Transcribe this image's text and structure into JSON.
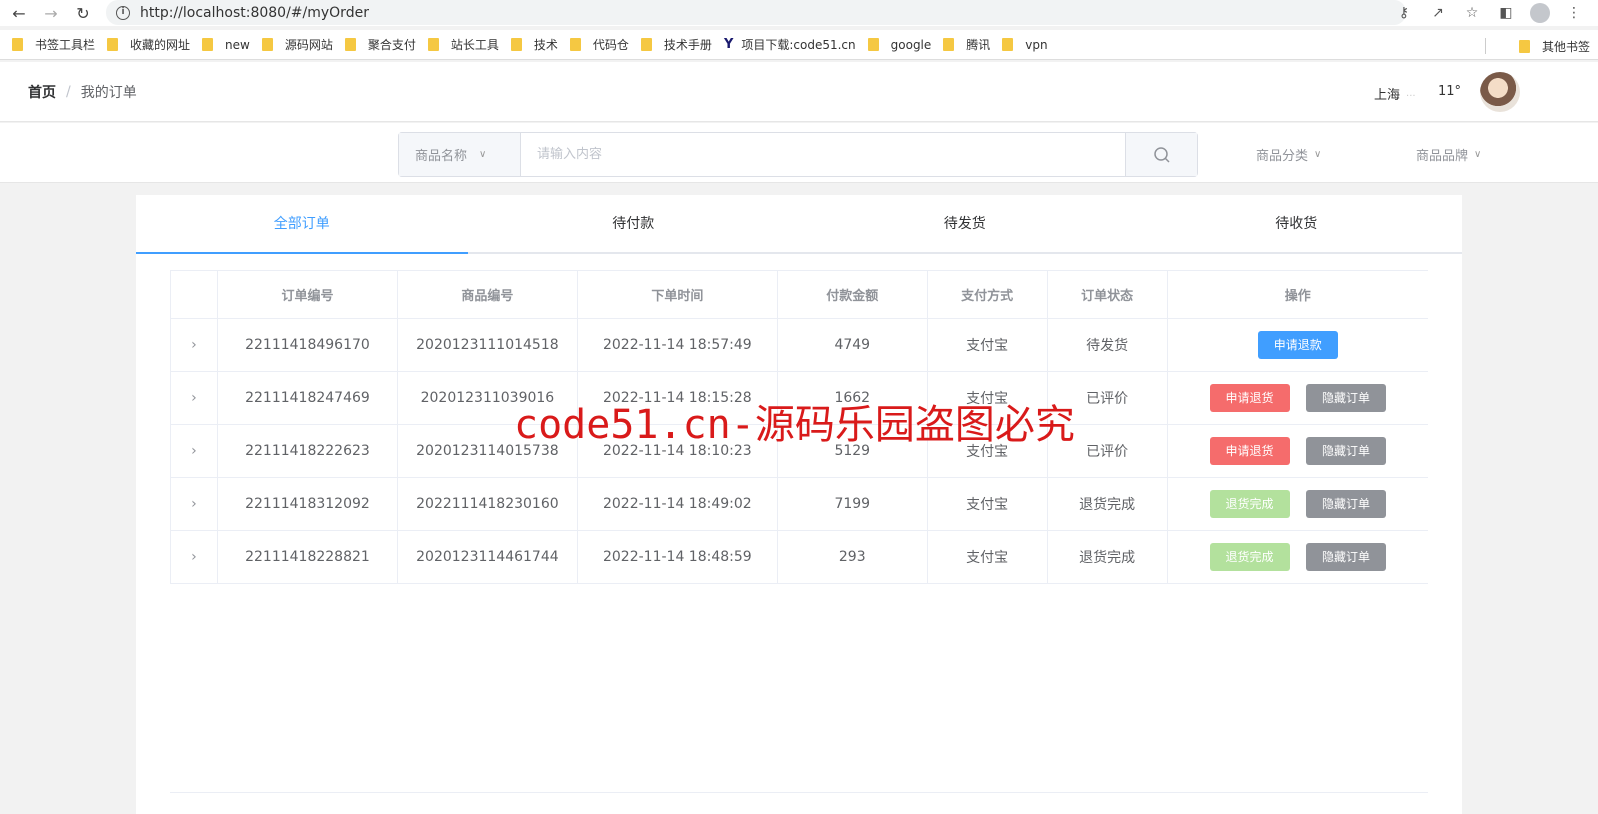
{
  "browser": {
    "url": "http://localhost:8080/#/myOrder",
    "bookmarks": [
      "书签工具栏",
      "收藏的网址",
      "new",
      "源码网站",
      "聚合支付",
      "站长工具",
      "技术",
      "代码仓",
      "技术手册"
    ],
    "bookmark_special": "项目下载:code51.cn",
    "bookmarks_tail": [
      "google",
      "腾讯",
      "vpn"
    ],
    "bookmark_other": "其他书签"
  },
  "header": {
    "breadcrumb_home": "首页",
    "breadcrumb_sep": "/",
    "breadcrumb_current": "我的订单",
    "city": "上海",
    "weather_dots": "...",
    "temperature": "11°"
  },
  "search": {
    "select_label": "商品名称",
    "placeholder": "请输入内容",
    "category_label": "商品分类",
    "brand_label": "商品品牌"
  },
  "tabs": [
    "全部订单",
    "待付款",
    "待发货",
    "待收货"
  ],
  "table": {
    "columns": [
      "订单编号",
      "商品编号",
      "下单时间",
      "付款金额",
      "支付方式",
      "订单状态",
      "操作"
    ],
    "rows": [
      {
        "order_no": "22111418496170",
        "product_no": "2020123111014518",
        "time": "2022-11-14 18:57:49",
        "amount": "4749",
        "pay": "支付宝",
        "status": "待发货",
        "actions": [
          "申请退款"
        ]
      },
      {
        "order_no": "22111418247469",
        "product_no": "202012311039016",
        "time": "2022-11-14 18:15:28",
        "amount": "1662",
        "pay": "支付宝",
        "status": "已评价",
        "actions": [
          "申请退货",
          "隐藏订单"
        ]
      },
      {
        "order_no": "22111418222623",
        "product_no": "2020123114015738",
        "time": "2022-11-14 18:10:23",
        "amount": "5129",
        "pay": "支付宝",
        "status": "已评价",
        "actions": [
          "申请退货",
          "隐藏订单"
        ]
      },
      {
        "order_no": "22111418312092",
        "product_no": "2022111418230160",
        "time": "2022-11-14 18:49:02",
        "amount": "7199",
        "pay": "支付宝",
        "status": "退货完成",
        "actions": [
          "退货完成",
          "隐藏订单"
        ]
      },
      {
        "order_no": "22111418228821",
        "product_no": "2020123114461744",
        "time": "2022-11-14 18:48:59",
        "amount": "293",
        "pay": "支付宝",
        "status": "退货完成",
        "actions": [
          "退货完成",
          "隐藏订单"
        ]
      }
    ]
  },
  "watermark": "code51.cn-源码乐园盗图必究",
  "colors": {
    "primary": "#409eff",
    "danger": "#f56c6c",
    "info": "#909399",
    "success_disabled": "#b3e19d"
  }
}
